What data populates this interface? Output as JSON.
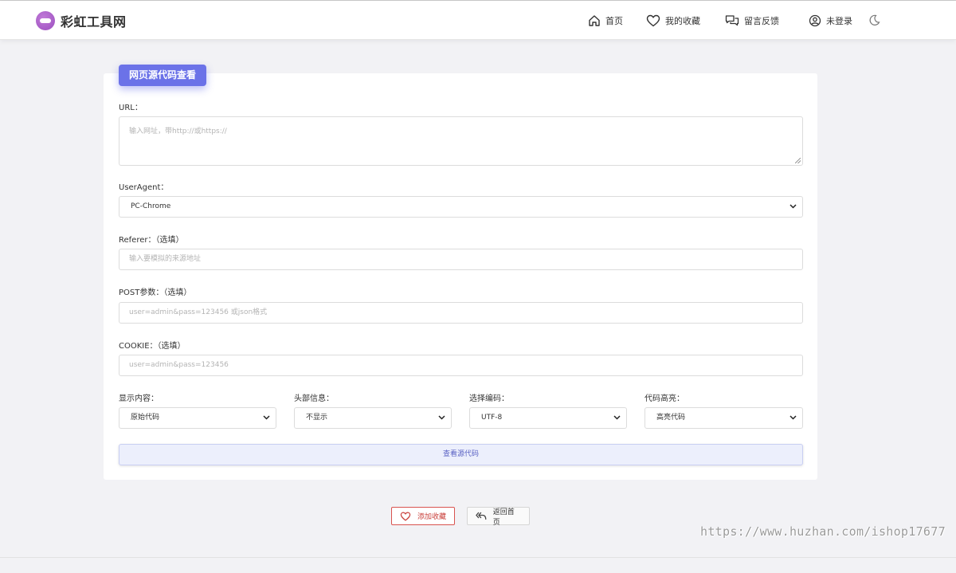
{
  "header": {
    "logo_text": "彩虹工具网",
    "nav": {
      "home": "首页",
      "favorites": "我的收藏",
      "feedback": "留言反馈",
      "login": "未登录"
    }
  },
  "card": {
    "title": "网页源代码查看",
    "url": {
      "label": "URL：",
      "placeholder": "输入网址，带http://或https://"
    },
    "user_agent": {
      "label": "UserAgent：",
      "value": "PC-Chrome"
    },
    "referer": {
      "label": "Referer：（选填）",
      "placeholder": "输入要模拟的来源地址"
    },
    "post": {
      "label": "POST参数：（选填）",
      "placeholder": "user=admin&pass=123456 或json格式"
    },
    "cookie": {
      "label": "COOKIE：（选填）",
      "placeholder": "user=admin&pass=123456"
    },
    "display": {
      "label": "显示内容：",
      "value": "原始代码"
    },
    "headers": {
      "label": "头部信息：",
      "value": "不显示"
    },
    "encoding": {
      "label": "选择编码：",
      "value": "UTF-8"
    },
    "highlight": {
      "label": "代码高亮：",
      "value": "高亮代码"
    },
    "submit_label": "查看源代码"
  },
  "actions": {
    "add_favorite": "添加收藏",
    "back_home": "返回首页"
  },
  "watermark": "https://www.huzhan.com/ishop17677",
  "colors": {
    "accent": "#6b72e8",
    "favorite": "#d9534f",
    "background": "#f2f2f5"
  }
}
